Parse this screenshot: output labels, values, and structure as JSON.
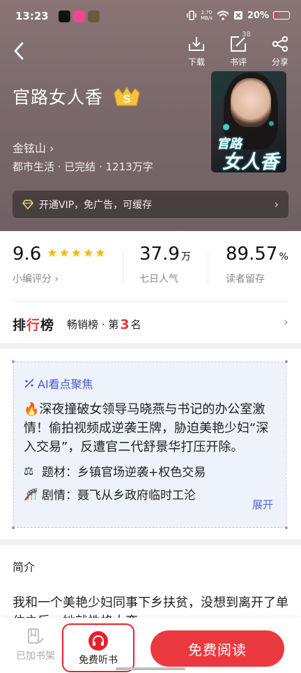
{
  "status": {
    "time": "13:23",
    "net_top": "2.70",
    "net_bottom": "MB/s",
    "battery": "20%"
  },
  "toolbar": {
    "download_label": "下载",
    "review_label": "书评",
    "review_count": "38",
    "share_label": "分享"
  },
  "book": {
    "title": "官路女人香",
    "badge": "S",
    "author": "金铉山",
    "meta": "都市生活 · 已完结 · 1213万字",
    "cover_line1": "官路",
    "cover_line2": "女人香"
  },
  "vip": {
    "text": "开通VIP，免广告，可缓存"
  },
  "stats": {
    "score": "9.6",
    "score_label": "小编评分",
    "stars": 5,
    "popularity": "37.9",
    "popularity_unit": "万",
    "popularity_label": "七日人气",
    "retention": "89.57",
    "retention_unit": "%",
    "retention_label": "读者留存"
  },
  "rank": {
    "logo_a": "排",
    "logo_b": "行",
    "logo_c": "榜",
    "list": "畅销榜 · 第",
    "number": "3",
    "suffix": "名"
  },
  "ai": {
    "heading": "AI看点聚焦",
    "desc": "🔥深夜撞破女领导马晓燕与书记的办公室激情！偷拍视频成逆袭王牌，胁迫美艳少妇“深入交易”，反遭官二代舒景华打压开除。",
    "genre_label": "题材：",
    "genre": "乡镇官场逆袭+权色交易",
    "plot_label": "剧情：",
    "plot": "聂飞从乡政府临时工沦",
    "more": "展开"
  },
  "intro": {
    "title": "简介",
    "text": "我和一个美艳少妇同事下乡扶贫，没想到离开了单位之后，她就性格大变……"
  },
  "bottom": {
    "shelf_label": "已加书架",
    "listen_label": "免费听书",
    "read_label": "免费阅读"
  },
  "colors": {
    "accent": "#ea3a3f",
    "star": "#ffb400",
    "ai_blue": "#4a5bd6"
  }
}
